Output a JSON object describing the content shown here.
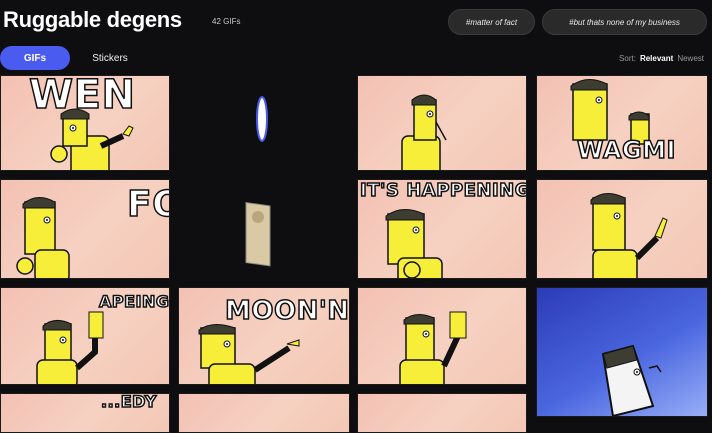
{
  "header": {
    "title": "Ruggable degens",
    "count": "42 GIFs"
  },
  "tags": [
    "#matter of fact",
    "#but thats none of my business"
  ],
  "tabs": [
    {
      "label": "GIFs",
      "active": true
    },
    {
      "label": "Stickers",
      "active": false
    }
  ],
  "sort": {
    "label": "Sort:",
    "options": [
      "Relevant",
      "Newest"
    ],
    "selected": "Relevant"
  },
  "tiles": [
    {
      "caption": "WEN"
    },
    {
      "caption": ""
    },
    {
      "caption": ""
    },
    {
      "caption": "WAGMI"
    },
    {
      "caption": "FO"
    },
    {
      "caption": ""
    },
    {
      "caption": "IT'S HAPPENING"
    },
    {
      "caption": ""
    },
    {
      "caption": "APEING"
    },
    {
      "caption": "MOON'N"
    },
    {
      "caption": ""
    },
    {
      "caption": ""
    },
    {
      "caption": "...EDY"
    }
  ],
  "colors": {
    "accent": "#4a5cf0",
    "background": "#0e0e10",
    "tile": "#f3c1b4",
    "character": "#f7ee3a"
  }
}
